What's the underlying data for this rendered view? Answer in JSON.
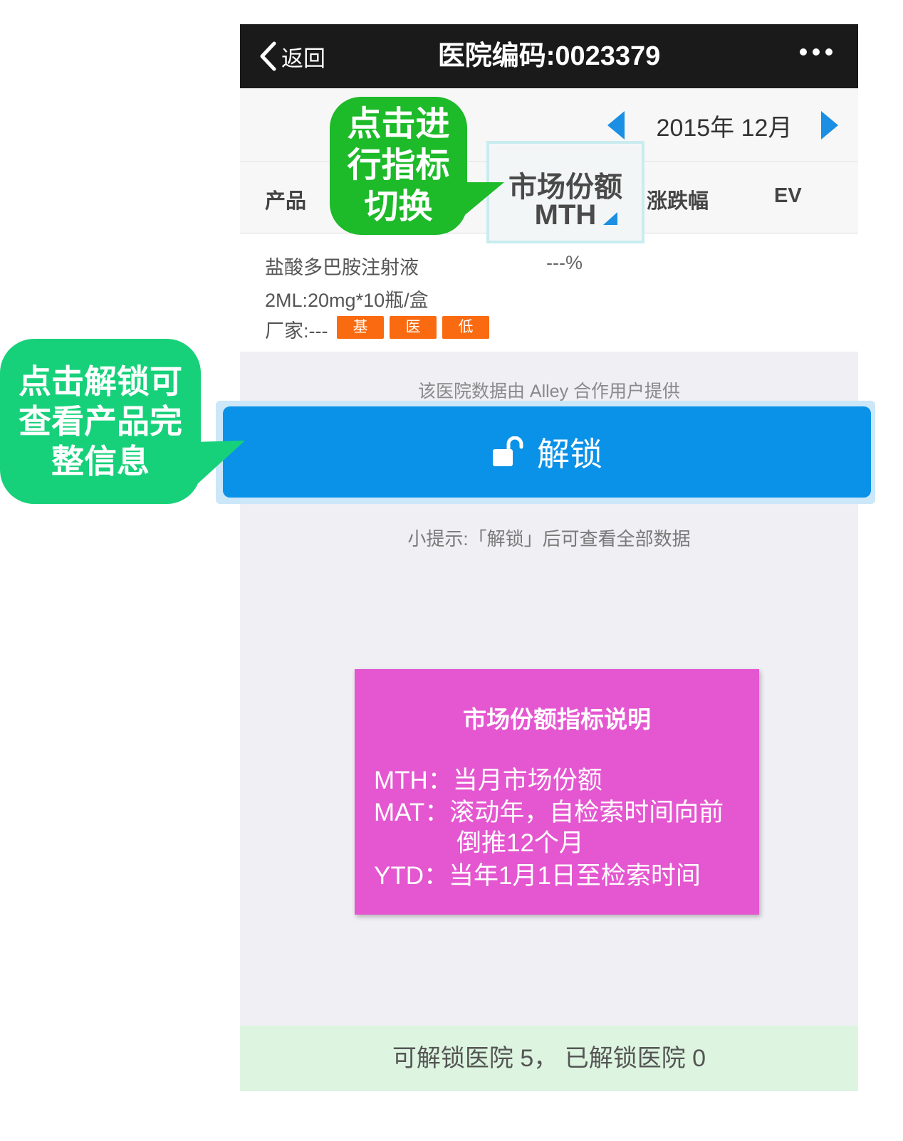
{
  "navbar": {
    "back_label": "返回",
    "title": "医院编码:0023379"
  },
  "date_bar": {
    "date": "2015年 12月"
  },
  "table_header": {
    "product": "产品",
    "metric_line1": "市场份额",
    "metric_line2": "MTH",
    "change": "涨跌幅",
    "ev": "EV"
  },
  "product": {
    "name": "盐酸多巴胺注射液",
    "spec": "2ML:20mg*10瓶/盒",
    "manufacturer": "厂家:---",
    "share": "---%",
    "tags": [
      "基",
      "医",
      "低"
    ]
  },
  "provider_note": "该医院数据由 Alley 合作用户提供",
  "unlock_label": "解锁",
  "tip": "小提示:「解锁」后可查看全部数据",
  "bottom_bar": "可解锁医院 5， 已解锁医院 0",
  "callouts": {
    "metric_switch": [
      "点击进",
      "行指标",
      "切换"
    ],
    "unlock": [
      "点击解锁可",
      "查看产品完",
      "整信息"
    ]
  },
  "info_box": {
    "title": "市场份额指标说明",
    "lines": [
      "MTH：当月市场份额",
      "MAT：滚动年，自检索时间向前",
      "倒推12个月",
      "YTD：当年1月1日至检索时间"
    ]
  },
  "colors": {
    "navbar_bg": "#1a1a1a",
    "accent_blue": "#0a92e8",
    "tag_orange": "#fa6a10",
    "callout_green": "#1dba29",
    "callout_mint": "#17d17a",
    "info_pink": "#e457d0",
    "bottom_green": "#ddf5e0"
  }
}
